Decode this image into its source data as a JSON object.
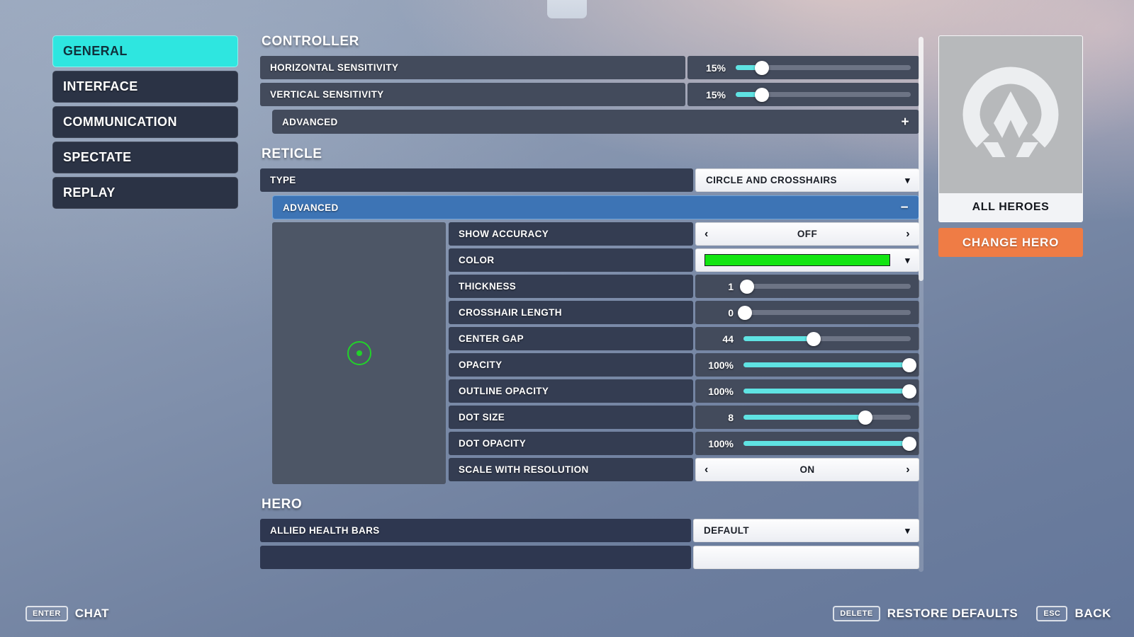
{
  "sidebar": {
    "items": [
      {
        "label": "GENERAL",
        "active": true
      },
      {
        "label": "INTERFACE",
        "active": false
      },
      {
        "label": "COMMUNICATION",
        "active": false
      },
      {
        "label": "SPECTATE",
        "active": false
      },
      {
        "label": "REPLAY",
        "active": false
      }
    ]
  },
  "sections": {
    "controller": {
      "title": "CONTROLLER",
      "rows": [
        {
          "label": "HORIZONTAL SENSITIVITY",
          "value": "15%",
          "percent": 15
        },
        {
          "label": "VERTICAL SENSITIVITY",
          "value": "15%",
          "percent": 15
        }
      ],
      "advanced": {
        "label": "ADVANCED",
        "sign": "+",
        "expanded": false
      }
    },
    "reticle": {
      "title": "RETICLE",
      "type": {
        "label": "TYPE",
        "value": "CIRCLE AND CROSSHAIRS"
      },
      "advanced": {
        "label": "ADVANCED",
        "sign": "−",
        "expanded": true
      },
      "preview": {
        "color": "#22d22a"
      },
      "rows": [
        {
          "label": "SHOW ACCURACY",
          "value": "OFF",
          "kind": "stepper"
        },
        {
          "label": "COLOR",
          "value": "",
          "kind": "color",
          "color": "#12e512"
        },
        {
          "label": "THICKNESS",
          "value": "1",
          "kind": "slider",
          "percent": 2
        },
        {
          "label": "CROSSHAIR LENGTH",
          "value": "0",
          "kind": "slider",
          "percent": 0
        },
        {
          "label": "CENTER GAP",
          "value": "44",
          "kind": "slider",
          "percent": 42
        },
        {
          "label": "OPACITY",
          "value": "100%",
          "kind": "slider",
          "percent": 100
        },
        {
          "label": "OUTLINE OPACITY",
          "value": "100%",
          "kind": "slider",
          "percent": 100
        },
        {
          "label": "DOT SIZE",
          "value": "8",
          "kind": "slider",
          "percent": 73
        },
        {
          "label": "DOT OPACITY",
          "value": "100%",
          "kind": "slider",
          "percent": 100
        },
        {
          "label": "SCALE WITH RESOLUTION",
          "value": "ON",
          "kind": "stepper"
        }
      ]
    },
    "hero": {
      "title": "HERO",
      "rows": [
        {
          "label": "ALLIED HEALTH BARS",
          "value": "DEFAULT"
        }
      ]
    }
  },
  "hero_panel": {
    "logo": "overwatch-logo-icon",
    "name": "ALL HEROES",
    "change_button": "CHANGE HERO",
    "accent": "#ef7c45"
  },
  "icons": {
    "chevron_down": "▾",
    "arrow_left": "‹",
    "arrow_right": "›"
  },
  "footer": {
    "left": {
      "key": "ENTER",
      "label": "CHAT"
    },
    "restore": {
      "key": "DELETE",
      "label": "RESTORE DEFAULTS"
    },
    "back": {
      "key": "ESC",
      "label": "BACK"
    }
  },
  "theme": {
    "accent_teal": "#5fe3e3",
    "active_tab": "#2ee6e0",
    "expanded_blue": "#3d74b5",
    "orange": "#ef7c45"
  }
}
